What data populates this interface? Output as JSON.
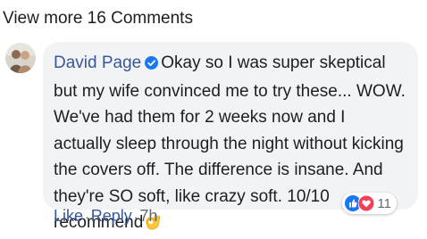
{
  "header": {
    "view_more_label": "View more 16 Comments"
  },
  "comment": {
    "author": "David Page",
    "text": "Okay so I was super skeptical but my wife convinced me to try these... WOW. We've had them for 2 weeks now and I actually sleep through the night without kicking the covers off. The difference is insane. And they're SO soft, like crazy soft. 10/10 recommend",
    "emoji_icon": "ok-hand-icon",
    "verified_icon": "verified-badge-icon",
    "reactions": {
      "icons": [
        "like-reaction-icon",
        "love-reaction-icon"
      ],
      "count": "11"
    }
  },
  "actions": {
    "like_label": "Like",
    "separator": "·",
    "reply_label": "Reply",
    "timestamp": "7h"
  },
  "colors": {
    "link": "#385898",
    "bubble": "#f2f3f5",
    "like_blue": "#1877f2",
    "love_red": "#f33e58",
    "meta_gray": "#606770"
  }
}
